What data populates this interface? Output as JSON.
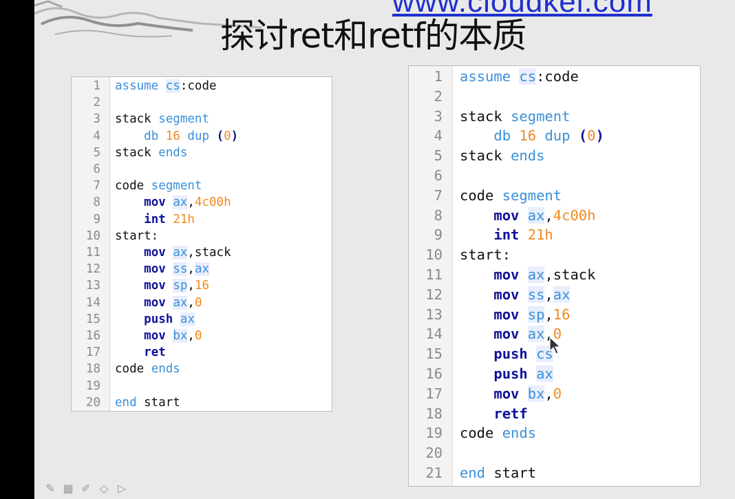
{
  "header": {
    "url": "www.cloudkei.com",
    "title": "探讨ret和retf的本质"
  },
  "left_code": {
    "lines": [
      {
        "n": "1",
        "tokens": [
          {
            "t": "assume",
            "c": "kw"
          },
          {
            "t": " ",
            "c": "plain"
          },
          {
            "t": "cs",
            "c": "reg"
          },
          {
            "t": ":code",
            "c": "plain"
          }
        ]
      },
      {
        "n": "2",
        "tokens": []
      },
      {
        "n": "3",
        "tokens": [
          {
            "t": "stack ",
            "c": "plain"
          },
          {
            "t": "segment",
            "c": "kw"
          }
        ]
      },
      {
        "n": "4",
        "tokens": [
          {
            "t": "    ",
            "c": "plain"
          },
          {
            "t": "db",
            "c": "kw"
          },
          {
            "t": " ",
            "c": "plain"
          },
          {
            "t": "16",
            "c": "num"
          },
          {
            "t": " ",
            "c": "plain"
          },
          {
            "t": "dup",
            "c": "kw"
          },
          {
            "t": " ",
            "c": "plain"
          },
          {
            "t": "(",
            "c": "paren"
          },
          {
            "t": "0",
            "c": "num"
          },
          {
            "t": ")",
            "c": "paren"
          }
        ]
      },
      {
        "n": "5",
        "tokens": [
          {
            "t": "stack ",
            "c": "plain"
          },
          {
            "t": "ends",
            "c": "kw"
          }
        ]
      },
      {
        "n": "6",
        "tokens": []
      },
      {
        "n": "7",
        "tokens": [
          {
            "t": "code ",
            "c": "plain"
          },
          {
            "t": "segment",
            "c": "kw"
          }
        ]
      },
      {
        "n": "8",
        "tokens": [
          {
            "t": "    ",
            "c": "plain"
          },
          {
            "t": "mov",
            "c": "instr"
          },
          {
            "t": " ",
            "c": "plain"
          },
          {
            "t": "ax",
            "c": "reg"
          },
          {
            "t": ",",
            "c": "plain"
          },
          {
            "t": "4c00h",
            "c": "num"
          }
        ]
      },
      {
        "n": "9",
        "tokens": [
          {
            "t": "    ",
            "c": "plain"
          },
          {
            "t": "int",
            "c": "instr"
          },
          {
            "t": " ",
            "c": "plain"
          },
          {
            "t": "21h",
            "c": "num"
          }
        ]
      },
      {
        "n": "10",
        "tokens": [
          {
            "t": "start:",
            "c": "plain"
          }
        ]
      },
      {
        "n": "11",
        "tokens": [
          {
            "t": "    ",
            "c": "plain"
          },
          {
            "t": "mov",
            "c": "instr"
          },
          {
            "t": " ",
            "c": "plain"
          },
          {
            "t": "ax",
            "c": "reg"
          },
          {
            "t": ",stack",
            "c": "plain"
          }
        ]
      },
      {
        "n": "12",
        "tokens": [
          {
            "t": "    ",
            "c": "plain"
          },
          {
            "t": "mov",
            "c": "instr"
          },
          {
            "t": " ",
            "c": "plain"
          },
          {
            "t": "ss",
            "c": "reg"
          },
          {
            "t": ",",
            "c": "plain"
          },
          {
            "t": "ax",
            "c": "reg"
          }
        ]
      },
      {
        "n": "13",
        "tokens": [
          {
            "t": "    ",
            "c": "plain"
          },
          {
            "t": "mov",
            "c": "instr"
          },
          {
            "t": " ",
            "c": "plain"
          },
          {
            "t": "sp",
            "c": "reg"
          },
          {
            "t": ",",
            "c": "plain"
          },
          {
            "t": "16",
            "c": "num"
          }
        ]
      },
      {
        "n": "14",
        "tokens": [
          {
            "t": "    ",
            "c": "plain"
          },
          {
            "t": "mov",
            "c": "instr"
          },
          {
            "t": " ",
            "c": "plain"
          },
          {
            "t": "ax",
            "c": "reg"
          },
          {
            "t": ",",
            "c": "plain"
          },
          {
            "t": "0",
            "c": "num"
          }
        ]
      },
      {
        "n": "15",
        "tokens": [
          {
            "t": "    ",
            "c": "plain"
          },
          {
            "t": "push",
            "c": "instr"
          },
          {
            "t": " ",
            "c": "plain"
          },
          {
            "t": "ax",
            "c": "reg"
          }
        ]
      },
      {
        "n": "16",
        "tokens": [
          {
            "t": "    ",
            "c": "plain"
          },
          {
            "t": "mov",
            "c": "instr"
          },
          {
            "t": " ",
            "c": "plain"
          },
          {
            "t": "bx",
            "c": "reg"
          },
          {
            "t": ",",
            "c": "plain"
          },
          {
            "t": "0",
            "c": "num"
          }
        ]
      },
      {
        "n": "17",
        "tokens": [
          {
            "t": "    ",
            "c": "plain"
          },
          {
            "t": "ret",
            "c": "instr"
          }
        ]
      },
      {
        "n": "18",
        "tokens": [
          {
            "t": "code ",
            "c": "plain"
          },
          {
            "t": "ends",
            "c": "kw"
          }
        ]
      },
      {
        "n": "19",
        "tokens": []
      },
      {
        "n": "20",
        "tokens": [
          {
            "t": "end",
            "c": "kw"
          },
          {
            "t": " start",
            "c": "plain"
          }
        ]
      }
    ]
  },
  "right_code": {
    "lines": [
      {
        "n": "1",
        "tokens": [
          {
            "t": "assume",
            "c": "kw"
          },
          {
            "t": " ",
            "c": "plain"
          },
          {
            "t": "cs",
            "c": "reg"
          },
          {
            "t": ":code",
            "c": "plain"
          }
        ]
      },
      {
        "n": "2",
        "tokens": []
      },
      {
        "n": "3",
        "tokens": [
          {
            "t": "stack ",
            "c": "plain"
          },
          {
            "t": "segment",
            "c": "kw"
          }
        ]
      },
      {
        "n": "4",
        "tokens": [
          {
            "t": "    ",
            "c": "plain"
          },
          {
            "t": "db",
            "c": "kw"
          },
          {
            "t": " ",
            "c": "plain"
          },
          {
            "t": "16",
            "c": "num"
          },
          {
            "t": " ",
            "c": "plain"
          },
          {
            "t": "dup",
            "c": "kw"
          },
          {
            "t": " ",
            "c": "plain"
          },
          {
            "t": "(",
            "c": "paren"
          },
          {
            "t": "0",
            "c": "num"
          },
          {
            "t": ")",
            "c": "paren"
          }
        ]
      },
      {
        "n": "5",
        "tokens": [
          {
            "t": "stack ",
            "c": "plain"
          },
          {
            "t": "ends",
            "c": "kw"
          }
        ]
      },
      {
        "n": "6",
        "tokens": []
      },
      {
        "n": "7",
        "tokens": [
          {
            "t": "code ",
            "c": "plain"
          },
          {
            "t": "segment",
            "c": "kw"
          }
        ]
      },
      {
        "n": "8",
        "tokens": [
          {
            "t": "    ",
            "c": "plain"
          },
          {
            "t": "mov",
            "c": "instr"
          },
          {
            "t": " ",
            "c": "plain"
          },
          {
            "t": "ax",
            "c": "reg"
          },
          {
            "t": ",",
            "c": "plain"
          },
          {
            "t": "4c00h",
            "c": "num"
          }
        ]
      },
      {
        "n": "9",
        "tokens": [
          {
            "t": "    ",
            "c": "plain"
          },
          {
            "t": "int",
            "c": "instr"
          },
          {
            "t": " ",
            "c": "plain"
          },
          {
            "t": "21h",
            "c": "num"
          }
        ]
      },
      {
        "n": "10",
        "tokens": [
          {
            "t": "start:",
            "c": "plain"
          }
        ]
      },
      {
        "n": "11",
        "tokens": [
          {
            "t": "    ",
            "c": "plain"
          },
          {
            "t": "mov",
            "c": "instr"
          },
          {
            "t": " ",
            "c": "plain"
          },
          {
            "t": "ax",
            "c": "reg"
          },
          {
            "t": ",stack",
            "c": "plain"
          }
        ]
      },
      {
        "n": "12",
        "tokens": [
          {
            "t": "    ",
            "c": "plain"
          },
          {
            "t": "mov",
            "c": "instr"
          },
          {
            "t": " ",
            "c": "plain"
          },
          {
            "t": "ss",
            "c": "reg"
          },
          {
            "t": ",",
            "c": "plain"
          },
          {
            "t": "ax",
            "c": "reg"
          }
        ]
      },
      {
        "n": "13",
        "tokens": [
          {
            "t": "    ",
            "c": "plain"
          },
          {
            "t": "mov",
            "c": "instr"
          },
          {
            "t": " ",
            "c": "plain"
          },
          {
            "t": "sp",
            "c": "reg"
          },
          {
            "t": ",",
            "c": "plain"
          },
          {
            "t": "16",
            "c": "num"
          }
        ]
      },
      {
        "n": "14",
        "tokens": [
          {
            "t": "    ",
            "c": "plain"
          },
          {
            "t": "mov",
            "c": "instr"
          },
          {
            "t": " ",
            "c": "plain"
          },
          {
            "t": "ax",
            "c": "reg"
          },
          {
            "t": ",",
            "c": "plain"
          },
          {
            "t": "0",
            "c": "num"
          }
        ]
      },
      {
        "n": "15",
        "tokens": [
          {
            "t": "    ",
            "c": "plain"
          },
          {
            "t": "push",
            "c": "instr"
          },
          {
            "t": " ",
            "c": "plain"
          },
          {
            "t": "cs",
            "c": "reg"
          }
        ]
      },
      {
        "n": "16",
        "tokens": [
          {
            "t": "    ",
            "c": "plain"
          },
          {
            "t": "push",
            "c": "instr"
          },
          {
            "t": " ",
            "c": "plain"
          },
          {
            "t": "ax",
            "c": "reg"
          }
        ]
      },
      {
        "n": "17",
        "tokens": [
          {
            "t": "    ",
            "c": "plain"
          },
          {
            "t": "mov",
            "c": "instr"
          },
          {
            "t": " ",
            "c": "plain"
          },
          {
            "t": "bx",
            "c": "reg"
          },
          {
            "t": ",",
            "c": "plain"
          },
          {
            "t": "0",
            "c": "num"
          }
        ]
      },
      {
        "n": "18",
        "tokens": [
          {
            "t": "    ",
            "c": "plain"
          },
          {
            "t": "retf",
            "c": "instr"
          }
        ]
      },
      {
        "n": "19",
        "tokens": [
          {
            "t": "code ",
            "c": "plain"
          },
          {
            "t": "ends",
            "c": "kw"
          }
        ]
      },
      {
        "n": "20",
        "tokens": []
      },
      {
        "n": "21",
        "tokens": [
          {
            "t": "end",
            "c": "kw"
          },
          {
            "t": " start",
            "c": "plain"
          }
        ]
      }
    ]
  },
  "toolbar": {
    "icons": [
      "pen-icon",
      "grid-icon",
      "highlighter-icon",
      "eraser-icon",
      "pointer-icon"
    ],
    "glyphs": [
      "✎",
      "▦",
      "✐",
      "◇",
      "▷"
    ]
  },
  "colors": {
    "keyword": "#3a8fd9",
    "instruction": "#10109a",
    "number": "#f08a20",
    "url": "#1f2fd0"
  }
}
